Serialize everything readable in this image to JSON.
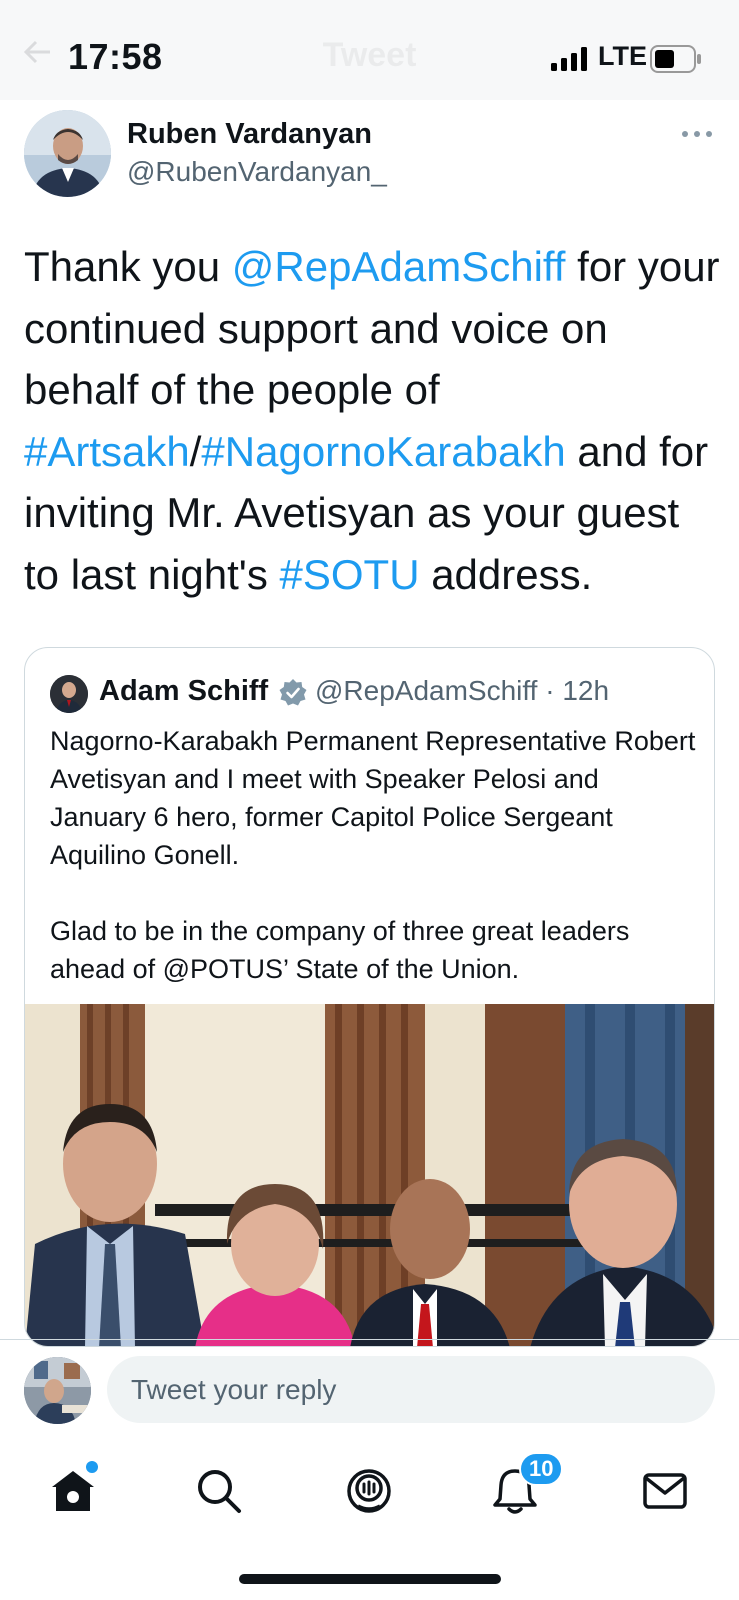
{
  "status_bar": {
    "time": "17:58",
    "network": "LTE",
    "header_title": "Tweet"
  },
  "tweet": {
    "author_name": "Ruben Vardanyan",
    "author_handle": "@RubenVardanyan_",
    "text_segments": [
      {
        "text": "Thank you ",
        "link": false
      },
      {
        "text": "@RepAdamSchiff",
        "link": true
      },
      {
        "text": " for your continued support and voice on behalf of the people of ",
        "link": false
      },
      {
        "text": "#Artsakh",
        "link": true
      },
      {
        "text": "/",
        "link": false
      },
      {
        "text": "#NagornoKarabakh",
        "link": true
      },
      {
        "text": " and for inviting Mr. Avetisyan as your guest to last night's ",
        "link": false
      },
      {
        "text": "#SOTU",
        "link": true
      },
      {
        "text": " address.",
        "link": false
      }
    ]
  },
  "quoted_tweet": {
    "author_name": "Adam Schiff",
    "handle_time": "@RepAdamSchiff · 12h",
    "paragraph_1": "Nagorno-Karabakh Permanent Representative Robert Avetisyan and I meet with Speaker Pelosi and January 6 hero, former Capitol Police Sergeant Aquilino Gonell.",
    "paragraph_2": "Glad to be in the company of three great leaders ahead of @POTUS’ State of the Union."
  },
  "reply": {
    "placeholder": "Tweet your reply"
  },
  "bottom_nav": {
    "items": [
      "home-icon",
      "search-icon",
      "spaces-icon",
      "notifications-icon",
      "messages-icon"
    ],
    "notification_count": "10"
  },
  "colors": {
    "accent": "#1d9bf0",
    "text": "#0f1419",
    "secondary": "#536471"
  }
}
